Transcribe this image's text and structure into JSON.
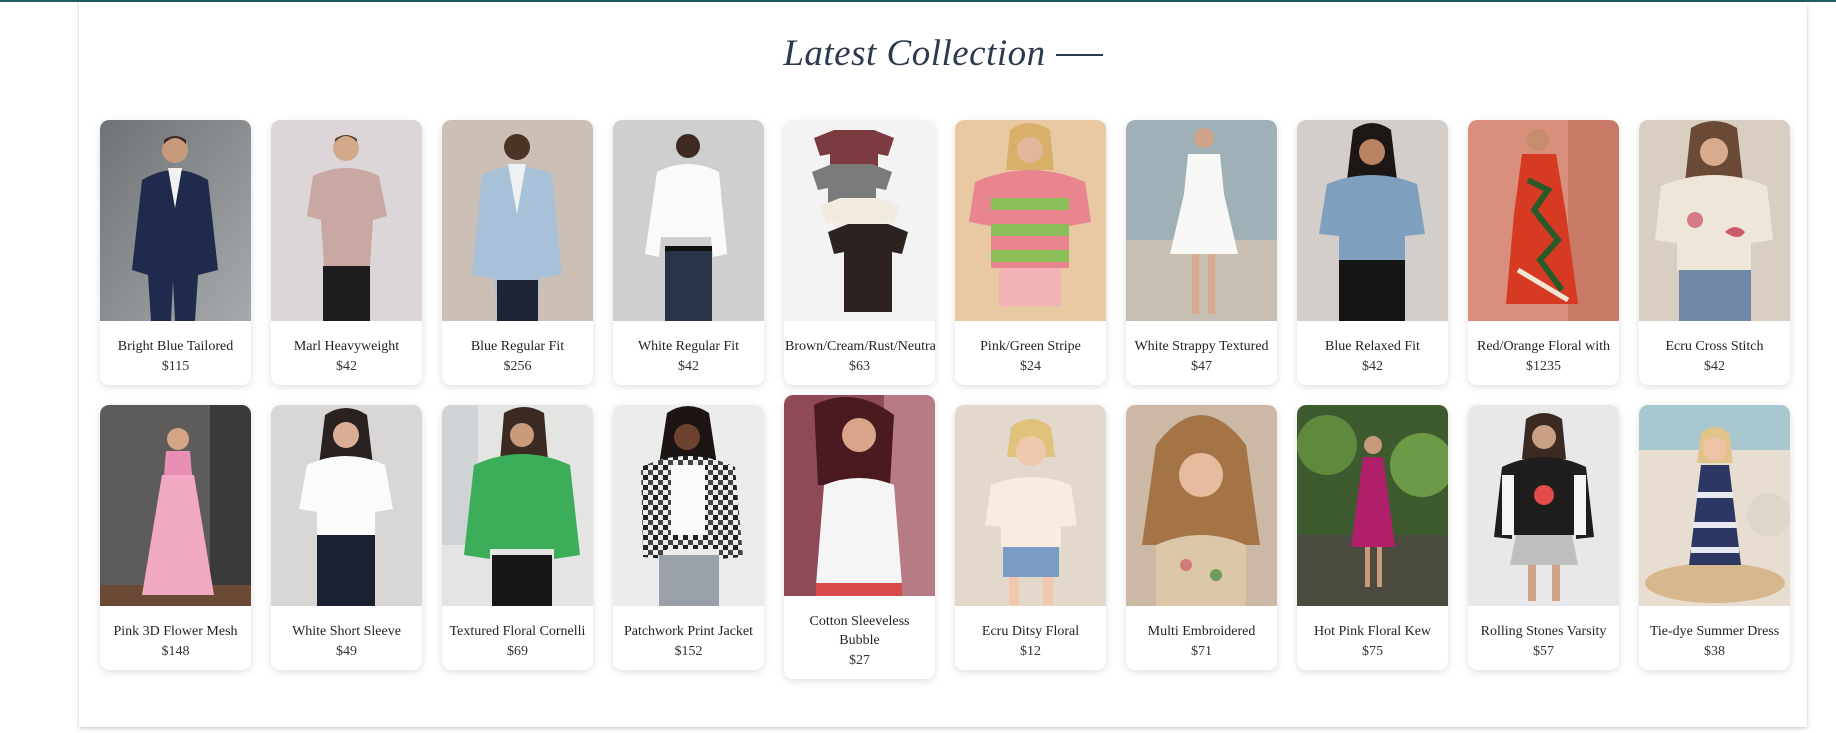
{
  "section": {
    "title": "Latest Collection"
  },
  "products_row1": [
    {
      "name": "Bright Blue Tailored",
      "price": "$115",
      "image": "man-navy-suit-photo"
    },
    {
      "name": "Marl Heavyweight",
      "price": "$42",
      "image": "man-pink-polo-photo"
    },
    {
      "name": "Blue Regular Fit",
      "price": "$256",
      "image": "man-blue-blazer-photo"
    },
    {
      "name": "White Regular Fit",
      "price": "$42",
      "image": "man-white-shirt-photo"
    },
    {
      "name": "Brown/Cream/Rust/Neutral",
      "price": "$63",
      "image": "tshirt-multipack-photo"
    },
    {
      "name": "Pink/Green Stripe",
      "price": "$24",
      "image": "woman-striped-tee-photo"
    },
    {
      "name": "White Strappy Textured",
      "price": "$47",
      "image": "woman-white-dress-photo"
    },
    {
      "name": "Blue Relaxed Fit",
      "price": "$42",
      "image": "woman-blue-tee-photo"
    },
    {
      "name": "Red/Orange Floral with",
      "price": "$1235",
      "image": "woman-floral-dress-photo"
    },
    {
      "name": "Ecru Cross Stitch",
      "price": "$42",
      "image": "woman-ecru-tee-photo"
    }
  ],
  "products_row2": [
    {
      "name": "Pink 3D Flower Mesh",
      "price": "$148",
      "image": "woman-pink-skirt-photo"
    },
    {
      "name": "White Short Sleeve",
      "price": "$49",
      "image": "woman-white-blouse-photo"
    },
    {
      "name": "Textured Floral Cornelli",
      "price": "$69",
      "image": "woman-green-blouse-photo"
    },
    {
      "name": "Patchwork Print Jacket",
      "price": "$152",
      "image": "woman-patchwork-jacket-photo"
    },
    {
      "name": "Cotton Sleeveless Bubble",
      "price": "$27",
      "image": "woman-white-tank-photo"
    },
    {
      "name": "Ecru Ditsy Floral",
      "price": "$12",
      "image": "toddler-floral-tee-photo"
    },
    {
      "name": "Multi Embroidered",
      "price": "$71",
      "image": "girl-embroidered-top-photo"
    },
    {
      "name": "Hot Pink Floral Kew",
      "price": "$75",
      "image": "girl-pink-dress-photo"
    },
    {
      "name": "Rolling Stones Varsity",
      "price": "$57",
      "image": "girl-varsity-jacket-photo"
    },
    {
      "name": "Tie-dye Summer Dress",
      "price": "$38",
      "image": "girl-tie-dye-dress-photo"
    }
  ],
  "colors": {
    "heading": "#2c3a4f",
    "accent_strip": "#1f5c64"
  }
}
